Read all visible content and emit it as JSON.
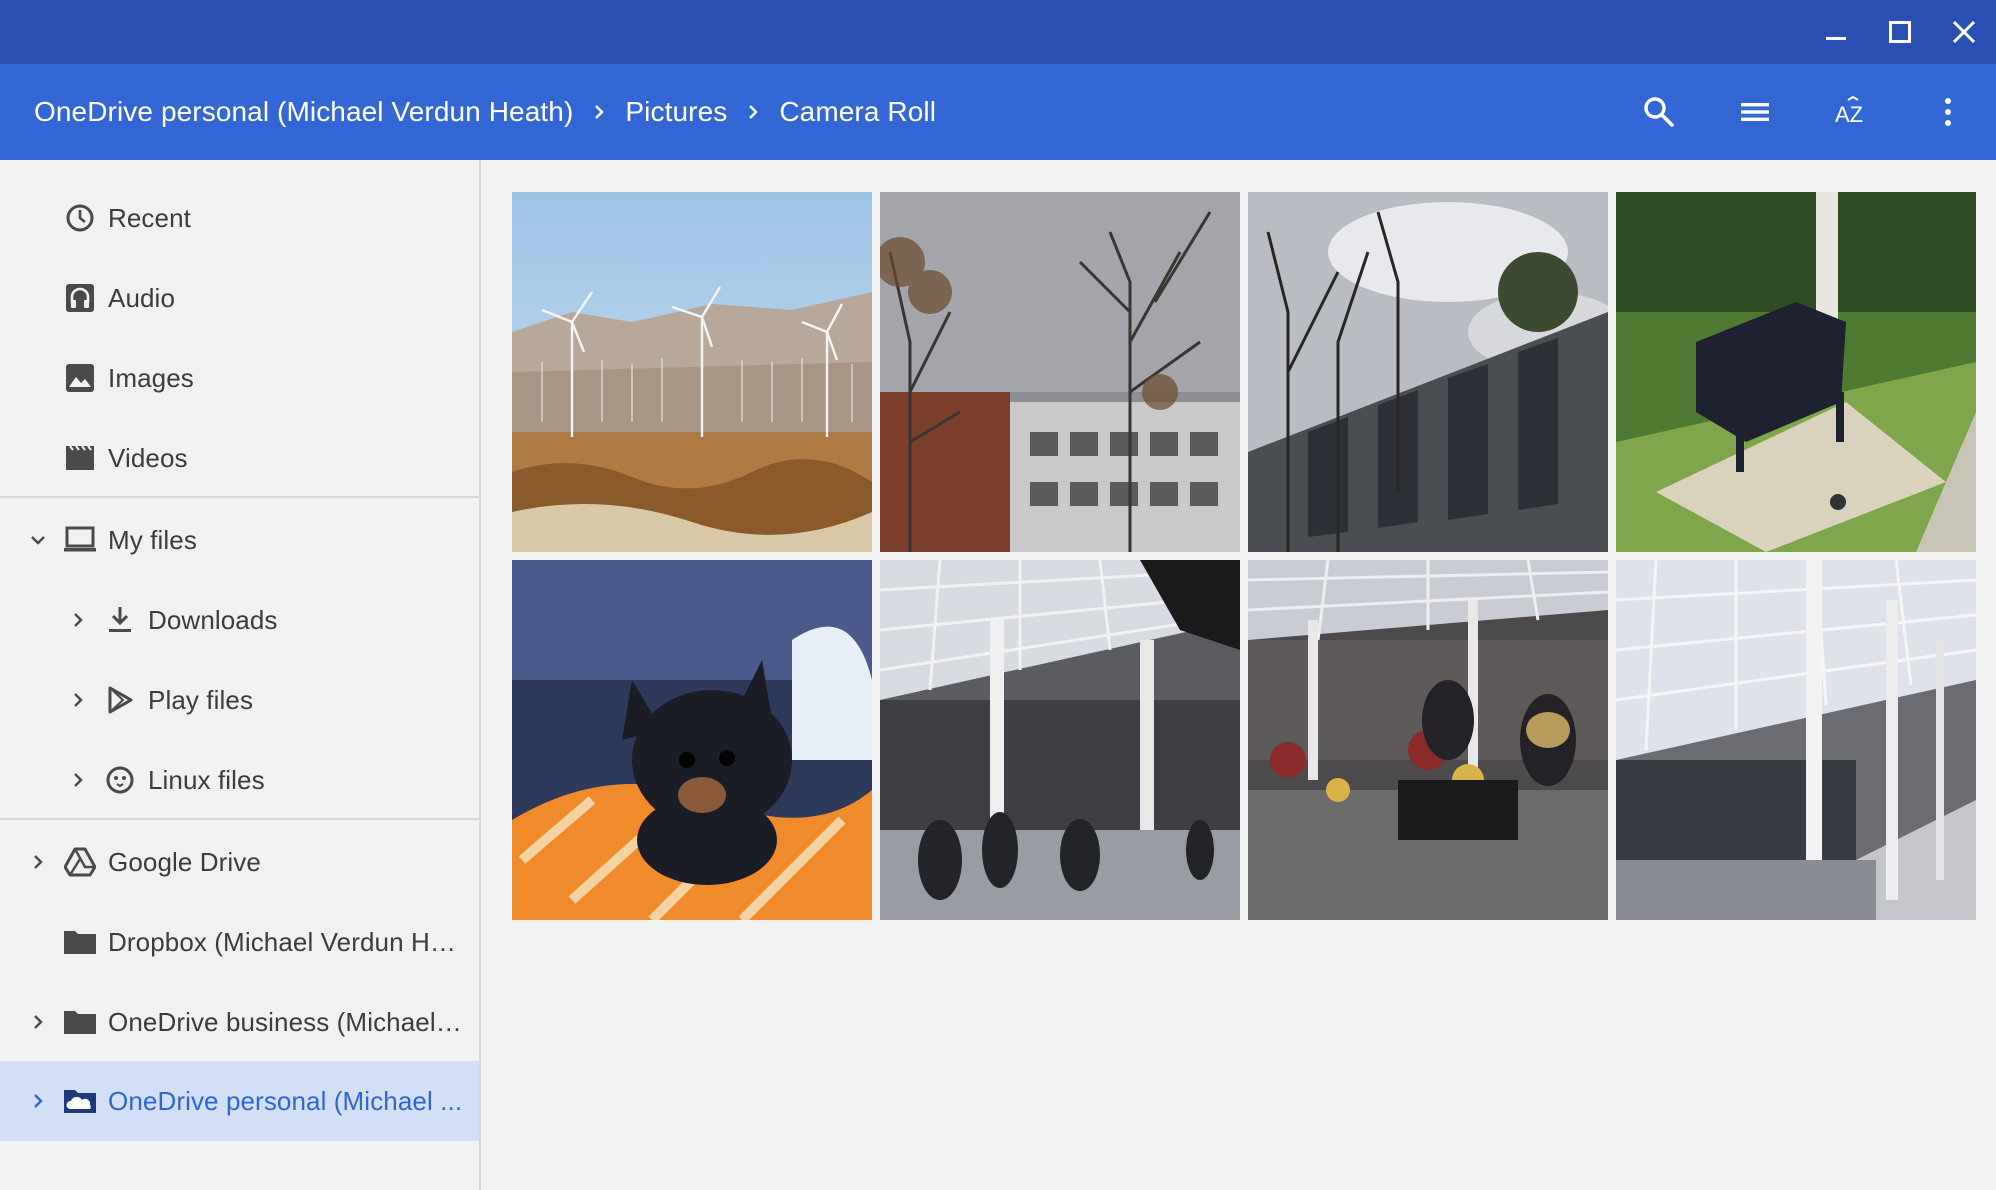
{
  "window": {
    "controls": {
      "minimize": "minimize-icon",
      "maximize": "maximize-icon",
      "close": "close-icon"
    }
  },
  "breadcrumb": {
    "items": [
      "OneDrive personal (Michael Verdun Heath)",
      "Pictures",
      "Camera Roll"
    ]
  },
  "toolbar": {
    "icons": [
      "search-icon",
      "list-view-icon",
      "sort-az-icon",
      "more-vert-icon"
    ],
    "sort_label": "AZ"
  },
  "sidebar": {
    "items": [
      {
        "label": "Recent",
        "icon": "clock-icon"
      },
      {
        "label": "Audio",
        "icon": "headphones-icon"
      },
      {
        "label": "Images",
        "icon": "image-icon"
      },
      {
        "label": "Videos",
        "icon": "film-icon"
      },
      {
        "label": "My files",
        "icon": "laptop-icon",
        "expanded": true
      },
      {
        "label": "Downloads",
        "icon": "download-icon"
      },
      {
        "label": "Play files",
        "icon": "play-store-icon"
      },
      {
        "label": "Linux files",
        "icon": "penguin-icon"
      },
      {
        "label": "Google Drive",
        "icon": "google-drive-icon"
      },
      {
        "label": "Dropbox (Michael Verdun He...",
        "icon": "folder-icon"
      },
      {
        "label": "OneDrive business (Michael ...",
        "icon": "folder-icon"
      },
      {
        "label": "OneDrive personal (Michael ...",
        "icon": "onedrive-icon",
        "selected": true
      }
    ]
  },
  "colors": {
    "titlebar": "#2b50b4",
    "header": "#3367d6",
    "selected_bg": "#d2dff7",
    "selected_text": "#2f66d4"
  },
  "grid": {
    "thumbnails": [
      {
        "subject": "wind farm in desert"
      },
      {
        "subject": "bare trees and building"
      },
      {
        "subject": "building with trees and cloudy sky"
      },
      {
        "subject": "black bench on lawn"
      },
      {
        "subject": "chihuahua in orange blanket"
      },
      {
        "subject": "shopping arcade with glass roof"
      },
      {
        "subject": "market stalls in arcade"
      },
      {
        "subject": "glass roof arcade with columns"
      }
    ]
  }
}
